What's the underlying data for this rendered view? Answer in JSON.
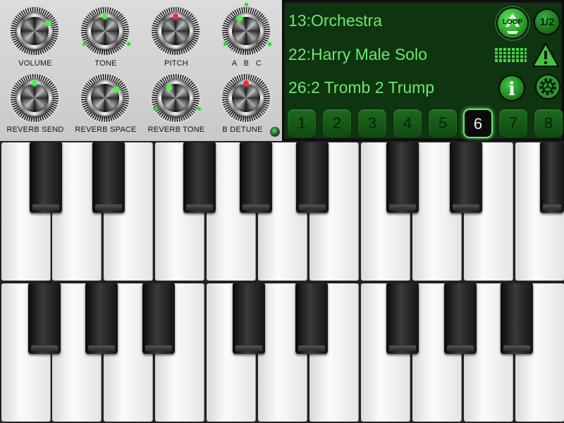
{
  "knobs": {
    "volume": {
      "label": "VOLUME",
      "dot_color": "#3cff3c"
    },
    "tone": {
      "label": "TONE",
      "dot_color": "#3cff3c"
    },
    "pitch": {
      "label": "PITCH",
      "dot_color": "#ff2a2a"
    },
    "abc": {
      "label": "A   B   C",
      "dot_color": "#3cff3c"
    },
    "reverb_send": {
      "label": "REVERB SEND",
      "dot_color": "#3cff3c"
    },
    "reverb_space": {
      "label": "REVERB SPACE",
      "dot_color": "#3cff3c"
    },
    "reverb_tone": {
      "label": "REVERB TONE",
      "dot_color": "#3cff3c"
    },
    "b_detune": {
      "label": "B DETUNE",
      "dot_color": "#ff2a2a"
    }
  },
  "display": {
    "presets": [
      "13:Orchestra",
      "22:Harry Male Solo",
      "26:2 Tromb 2 Trump"
    ],
    "loop_label": "LOOP",
    "half_label": "1/2",
    "info_label": "i",
    "slots": [
      "1",
      "2",
      "3",
      "4",
      "5",
      "6",
      "7",
      "8"
    ],
    "active_slot": "6"
  },
  "icons": {
    "loop": "recycle-icon",
    "meter": "level-meter-icon",
    "warning": "warning-icon",
    "info": "info-icon",
    "settings": "gear-icon",
    "status": "status-led"
  },
  "colors": {
    "lcd_background": "#0f3410",
    "lcd_text": "#6ee86e",
    "accent_green": "#3cff3c",
    "accent_red": "#ff2a2a"
  }
}
